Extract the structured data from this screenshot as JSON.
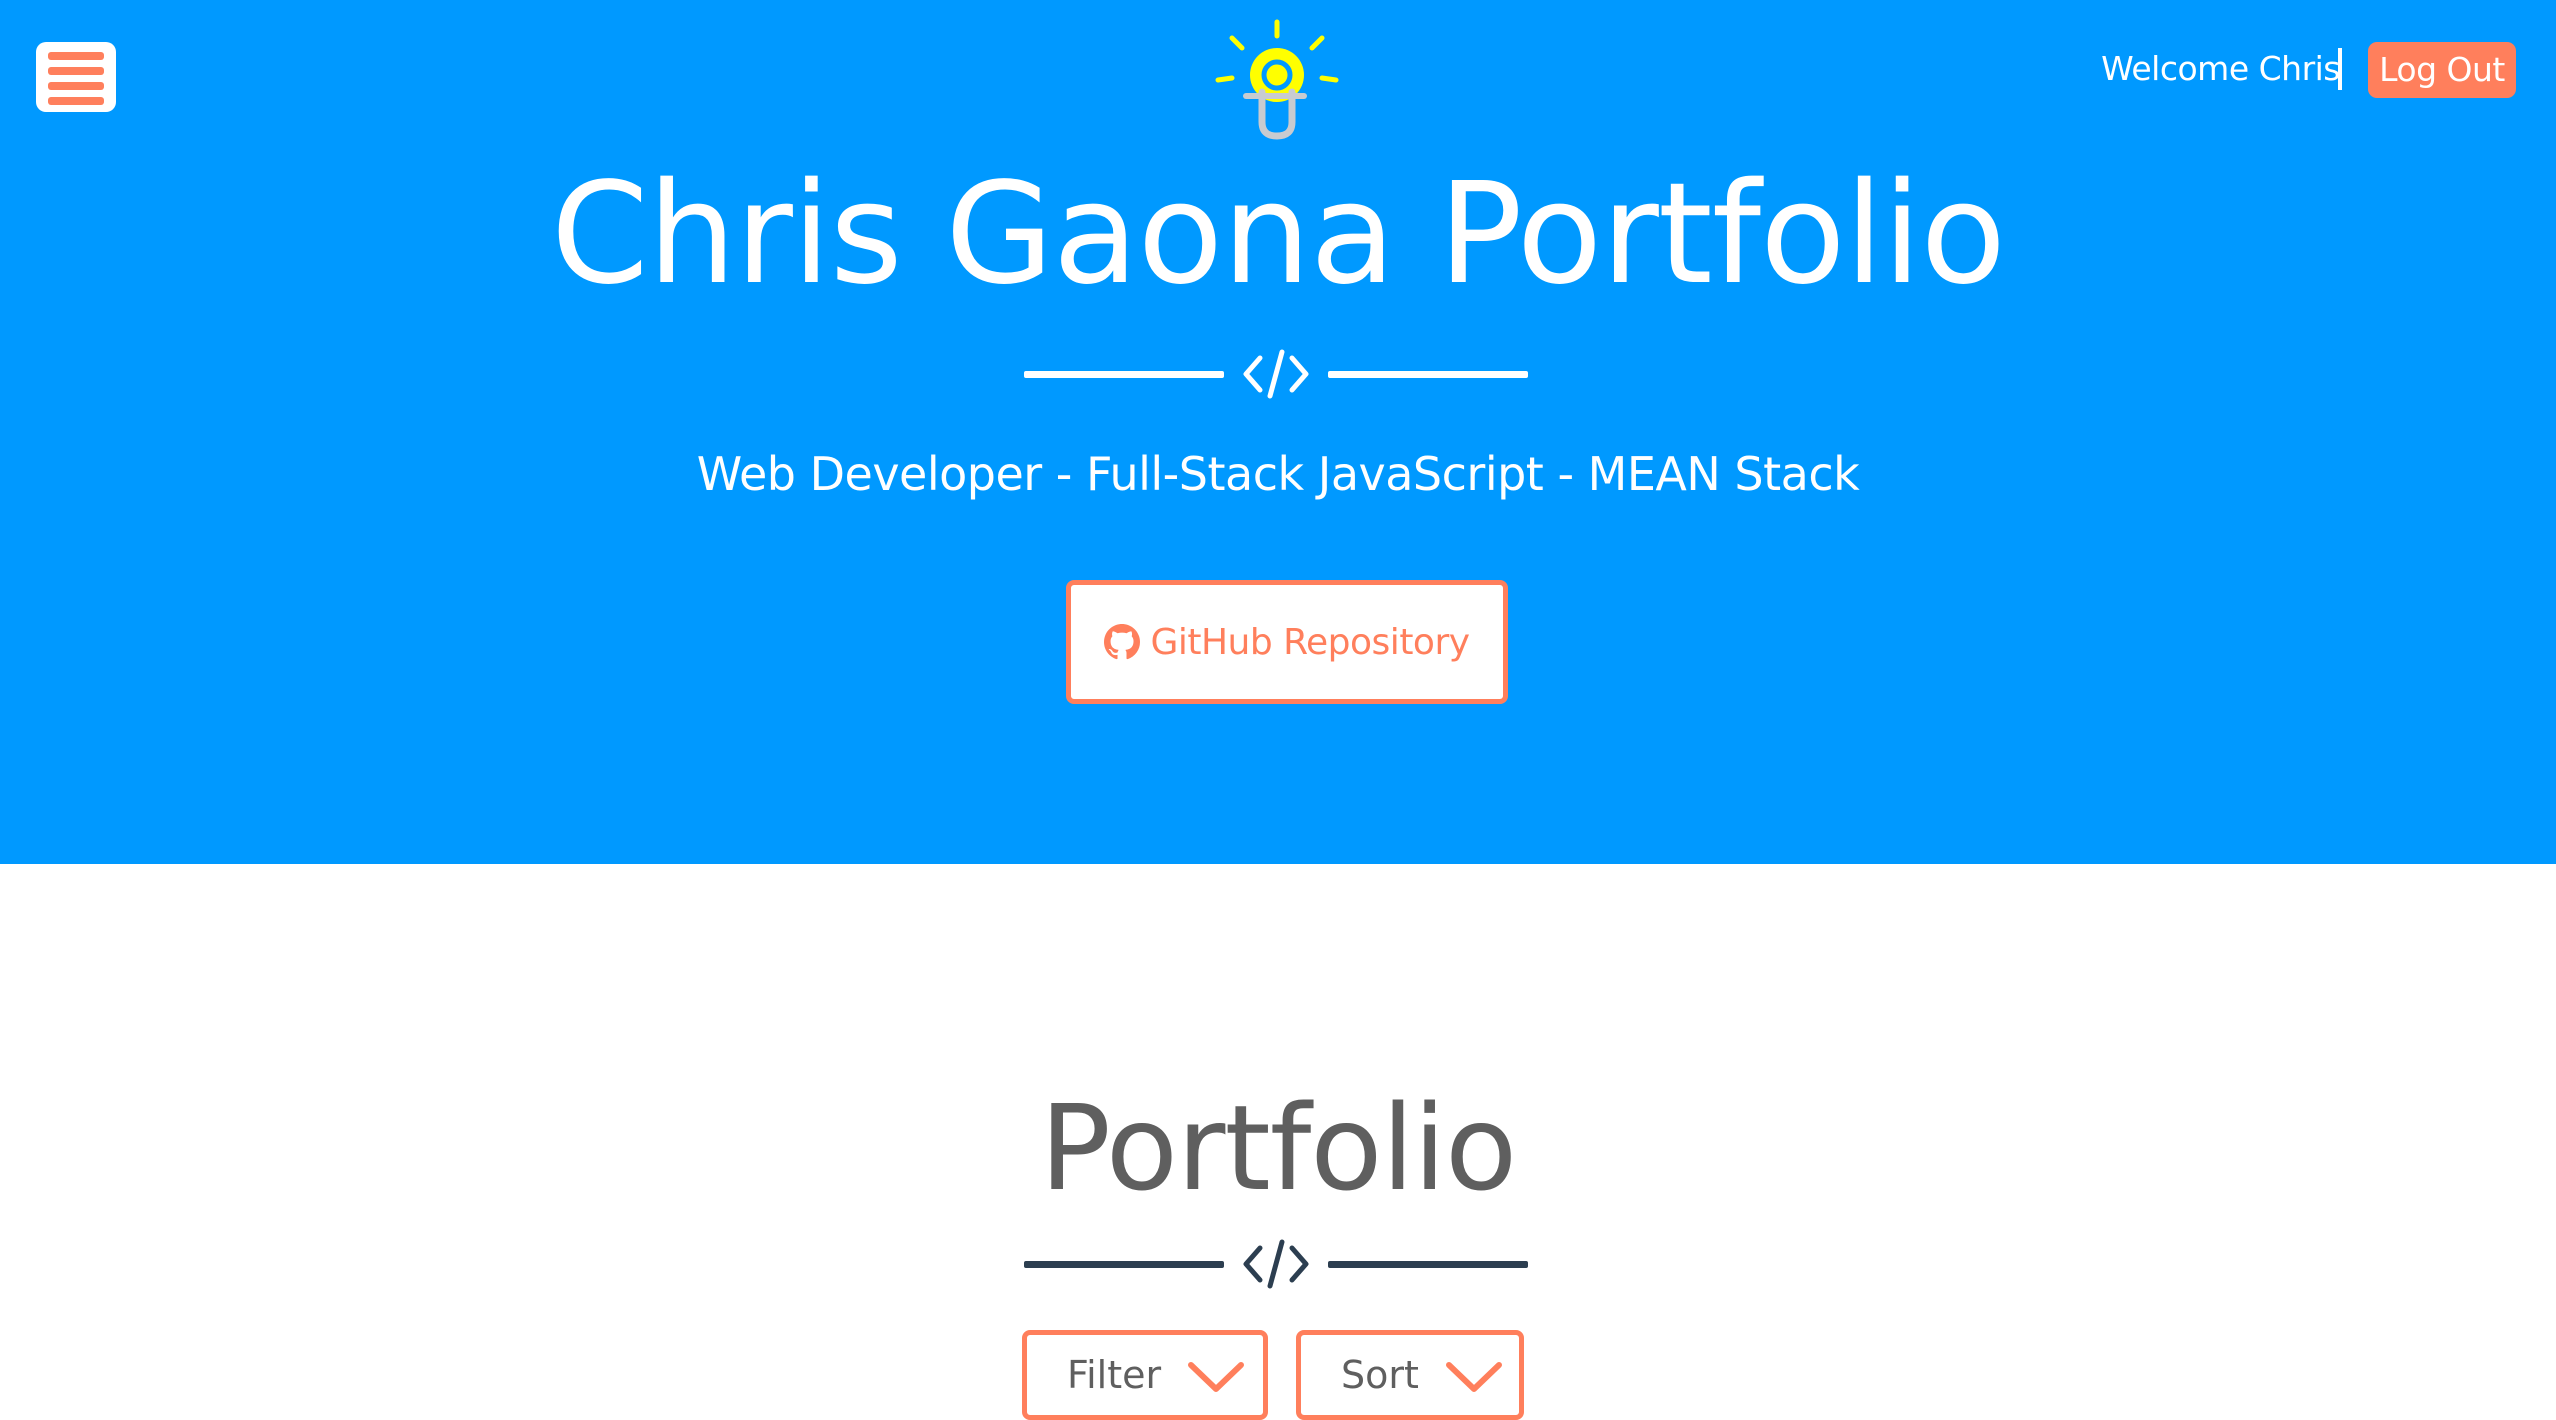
{
  "colors": {
    "hero_background": "#0099ff",
    "accent": "#ff7f5c",
    "divider_dark": "#2c3e50",
    "text_gray": "#5f5f5f",
    "white": "#ffffff",
    "logo_bulb": "#ffff00"
  },
  "header": {
    "menu_icon": "hamburger-icon",
    "logo_icon": "lightbulb-icon",
    "welcome_text": "Welcome Chris",
    "logout_label": "Log Out"
  },
  "hero": {
    "title": "Chris Gaona Portfolio",
    "divider_icon": "code-icon",
    "subtitle": "Web Developer - Full-Stack JavaScript - MEAN Stack",
    "github_icon": "github-icon",
    "github_label": "GitHub Repository"
  },
  "portfolio": {
    "title": "Portfolio",
    "divider_icon": "code-icon",
    "filter_label": "Filter",
    "sort_label": "Sort",
    "chevron_icon": "chevron-down-icon"
  }
}
